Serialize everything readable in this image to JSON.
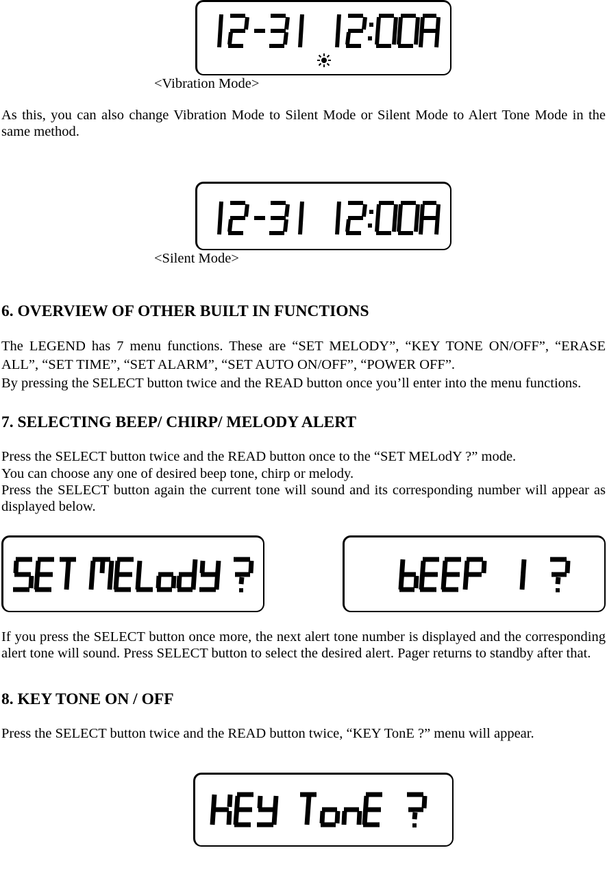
{
  "lcd1": {
    "content": "12-31  12:00A",
    "caption": "<Vibration Mode>",
    "icon": "vibration"
  },
  "para1": "As this, you can also change Vibration Mode to Silent Mode or Silent Mode to Alert Tone Mode in the same method.",
  "lcd2": {
    "content": "12-31  12:00A",
    "caption": "<Silent Mode>",
    "icon": null
  },
  "section6": {
    "heading": "6. OVERVIEW OF OTHER BUILT IN FUNCTIONS",
    "p1": "The LEGEND has 7 menu functions. These are “SET MELODY”, “KEY TONE ON/OFF”, “ERASE ALL”, “SET TIME”, “SET ALARM”, “SET AUTO ON/OFF”, “POWER OFF”.",
    "p2": "By pressing the SELECT button twice and the READ button once you’ll enter into the menu functions."
  },
  "section7": {
    "heading": "7. SELECTING BEEP/ CHIRP/ MELODY ALERT",
    "p1": "Press the SELECT button twice and the READ button once to the “SET MELodY ?” mode.",
    "p2": "You can choose any one of desired beep tone, chirp or melody.",
    "p3": "Press the SELECT button again the current tone will sound and its corresponding number will appear as displayed below.",
    "lcd_left": "SET MELodY ?",
    "lcd_right": "bEEP  1 ?",
    "p4": " If you press the SELECT button once more, the next alert tone number is displayed and the corresponding alert tone will sound. Press SELECT button to select the desired alert. Pager returns to standby after that."
  },
  "section8": {
    "heading": "8. KEY TONE ON / OFF",
    "p1": "Press the SELECT button twice and the READ button twice, “KEY TonE ?” menu will appear.",
    "lcd": "KEY TonE ?"
  }
}
